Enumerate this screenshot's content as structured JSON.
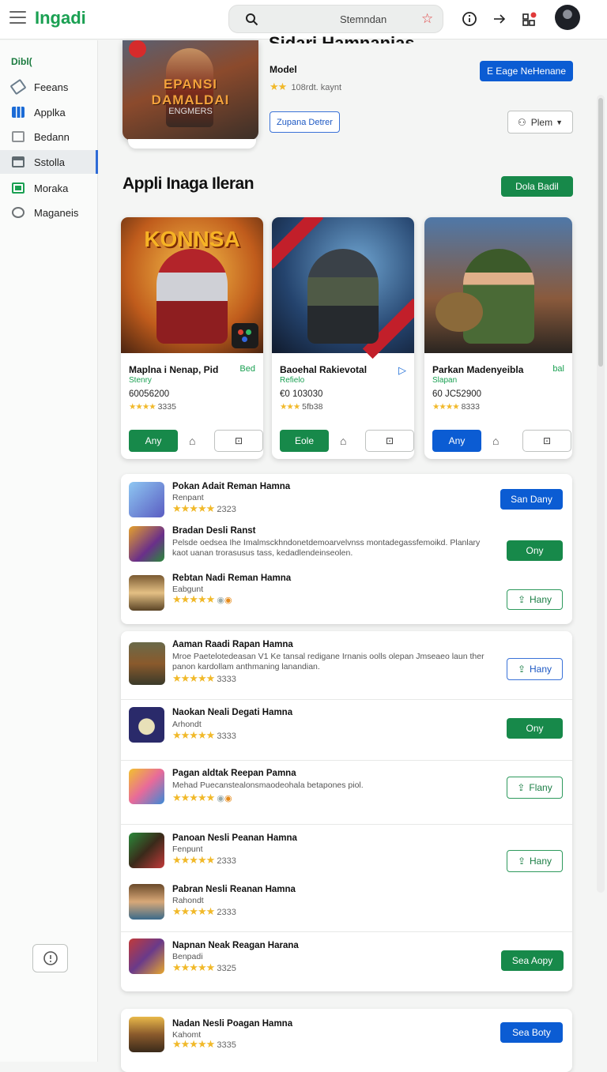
{
  "header": {
    "app_name": "Ingadi",
    "search_query": "Stemndan"
  },
  "sidebar": {
    "section": "Dibl(",
    "items": [
      {
        "label": "Feeans",
        "color": "#6b7d8c"
      },
      {
        "label": "Applka",
        "color": "#1b6bd6"
      },
      {
        "label": "Bedann",
        "color": "#8e9295"
      },
      {
        "label": "Sstolla",
        "color": "#5f6a70"
      },
      {
        "label": "Moraka",
        "color": "#1aa052"
      },
      {
        "label": "Maganeis",
        "color": "#6d7275"
      }
    ]
  },
  "hero": {
    "title_partial": "Sidari Hamnanias",
    "model_label": "Model",
    "rating_text": "108rdt. kaynt",
    "primary_button": "E Eage NeHenane",
    "secondary_button": "Zupana Detrer",
    "filter_button": "Plem",
    "image_title": "EPANSI DAMALDAI",
    "image_subtitle": "ENGMERS"
  },
  "section": {
    "title": "Appli Inaga Ileran",
    "action": "Dola Badil"
  },
  "featured": [
    {
      "art_title": "KONNSA",
      "name": "Maplna i Nenap, Pid",
      "tag": "Bed",
      "sub": "Stenry",
      "number": "60056200",
      "rating": "3335",
      "primary": "Any",
      "accent": "#17894a"
    },
    {
      "art_title": "",
      "name": "Baoehal Rakievotal",
      "tag": "▷",
      "sub": "Refielo",
      "number": "€0 103030",
      "rating": "5fb38",
      "primary": "Eole",
      "accent": "#17894a"
    },
    {
      "art_title": "",
      "name": "Parkan Madenyeibla",
      "tag": "bal",
      "sub": "Slapan",
      "number": "60 JC52900",
      "rating": "8333",
      "primary": "Any",
      "accent": "#0b5cd3"
    }
  ],
  "list_group_1": [
    {
      "name": "Pokan Adait Reman Hamna",
      "sub": "Renpant",
      "rating": "2323",
      "button": "San Dany",
      "style": "blue"
    },
    {
      "name": "Bradan Desli Ranst",
      "sub": "Pelsde oedsea Ihe Imalmsckhndonetdemoarvelvnss montadegassfemoikd. Planlary kaot uanan trorasusus tass, kedadlendeinseolen.",
      "rating": "",
      "button": "Ony",
      "style": "green"
    },
    {
      "name": "Rebtan Nadi Reman Hamna",
      "sub": "Eabgunt",
      "rating": "",
      "button": "Hany",
      "style": "outline"
    }
  ],
  "list_group_2": [
    {
      "name": "Aaman Raadi Rapan Hamna",
      "sub": "Mroe Paetelotedeasan V1 Ke tansal redigane Irnanis oolls olepan Jmseaeo laun ther panon kardollam anthmaning lanandian.",
      "rating": "3333",
      "button": "Hany",
      "style": "outline"
    },
    {
      "name": "Naokan Neali Degati Hamna",
      "sub": "Arhondt",
      "rating": "3333",
      "button": "Ony",
      "style": "green"
    },
    {
      "name": "Pagan aldtak Reepan Pamna",
      "sub": "Mehad Puecanstealonsmaodeohala betapones piol.",
      "rating": "",
      "button": "Flany",
      "style": "outline"
    },
    {
      "name": "Panoan Nesli Peanan Hamna",
      "sub": "Fenpunt",
      "rating": "2333",
      "button": "Hany",
      "style": "outline"
    },
    {
      "name": "Pabran Nesli Reanan Hamna",
      "sub": "Rahondt",
      "rating": "2333",
      "button": "",
      "style": "none"
    },
    {
      "name": "Napnan Neak Reagan Harana",
      "sub": "Benpadi",
      "rating": "3325",
      "button": "Sea Aopy",
      "style": "green"
    }
  ],
  "list_group_3": [
    {
      "name": "Nadan Nesli Poagan Hamna",
      "sub": "Kahomt",
      "rating": "3335",
      "button": "Sea Boty",
      "style": "blue"
    }
  ]
}
